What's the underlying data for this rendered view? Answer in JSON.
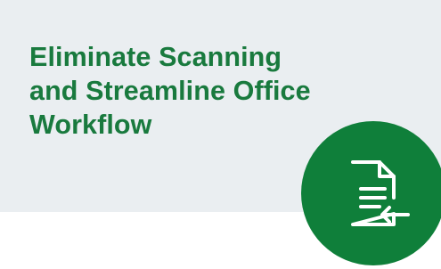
{
  "card": {
    "title_lines": [
      "Eliminate Scanning",
      "and Streamline Office",
      "Workflow"
    ],
    "icon": "document-return-icon",
    "colors": {
      "card_background": "#eaeef1",
      "title": "#197a3e",
      "icon_circle": "#0f7f3a",
      "icon_stroke": "#ffffff"
    }
  }
}
